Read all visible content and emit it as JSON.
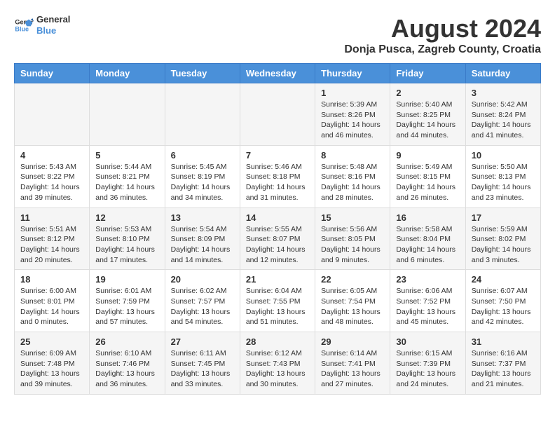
{
  "logo": {
    "line1": "General",
    "line2": "Blue"
  },
  "title": {
    "month_year": "August 2024",
    "location": "Donja Pusca, Zagreb County, Croatia"
  },
  "days_of_week": [
    "Sunday",
    "Monday",
    "Tuesday",
    "Wednesday",
    "Thursday",
    "Friday",
    "Saturday"
  ],
  "weeks": [
    [
      {
        "day": "",
        "info": ""
      },
      {
        "day": "",
        "info": ""
      },
      {
        "day": "",
        "info": ""
      },
      {
        "day": "",
        "info": ""
      },
      {
        "day": "1",
        "info": "Sunrise: 5:39 AM\nSunset: 8:26 PM\nDaylight: 14 hours\nand 46 minutes."
      },
      {
        "day": "2",
        "info": "Sunrise: 5:40 AM\nSunset: 8:25 PM\nDaylight: 14 hours\nand 44 minutes."
      },
      {
        "day": "3",
        "info": "Sunrise: 5:42 AM\nSunset: 8:24 PM\nDaylight: 14 hours\nand 41 minutes."
      }
    ],
    [
      {
        "day": "4",
        "info": "Sunrise: 5:43 AM\nSunset: 8:22 PM\nDaylight: 14 hours\nand 39 minutes."
      },
      {
        "day": "5",
        "info": "Sunrise: 5:44 AM\nSunset: 8:21 PM\nDaylight: 14 hours\nand 36 minutes."
      },
      {
        "day": "6",
        "info": "Sunrise: 5:45 AM\nSunset: 8:19 PM\nDaylight: 14 hours\nand 34 minutes."
      },
      {
        "day": "7",
        "info": "Sunrise: 5:46 AM\nSunset: 8:18 PM\nDaylight: 14 hours\nand 31 minutes."
      },
      {
        "day": "8",
        "info": "Sunrise: 5:48 AM\nSunset: 8:16 PM\nDaylight: 14 hours\nand 28 minutes."
      },
      {
        "day": "9",
        "info": "Sunrise: 5:49 AM\nSunset: 8:15 PM\nDaylight: 14 hours\nand 26 minutes."
      },
      {
        "day": "10",
        "info": "Sunrise: 5:50 AM\nSunset: 8:13 PM\nDaylight: 14 hours\nand 23 minutes."
      }
    ],
    [
      {
        "day": "11",
        "info": "Sunrise: 5:51 AM\nSunset: 8:12 PM\nDaylight: 14 hours\nand 20 minutes."
      },
      {
        "day": "12",
        "info": "Sunrise: 5:53 AM\nSunset: 8:10 PM\nDaylight: 14 hours\nand 17 minutes."
      },
      {
        "day": "13",
        "info": "Sunrise: 5:54 AM\nSunset: 8:09 PM\nDaylight: 14 hours\nand 14 minutes."
      },
      {
        "day": "14",
        "info": "Sunrise: 5:55 AM\nSunset: 8:07 PM\nDaylight: 14 hours\nand 12 minutes."
      },
      {
        "day": "15",
        "info": "Sunrise: 5:56 AM\nSunset: 8:05 PM\nDaylight: 14 hours\nand 9 minutes."
      },
      {
        "day": "16",
        "info": "Sunrise: 5:58 AM\nSunset: 8:04 PM\nDaylight: 14 hours\nand 6 minutes."
      },
      {
        "day": "17",
        "info": "Sunrise: 5:59 AM\nSunset: 8:02 PM\nDaylight: 14 hours\nand 3 minutes."
      }
    ],
    [
      {
        "day": "18",
        "info": "Sunrise: 6:00 AM\nSunset: 8:01 PM\nDaylight: 14 hours\nand 0 minutes."
      },
      {
        "day": "19",
        "info": "Sunrise: 6:01 AM\nSunset: 7:59 PM\nDaylight: 13 hours\nand 57 minutes."
      },
      {
        "day": "20",
        "info": "Sunrise: 6:02 AM\nSunset: 7:57 PM\nDaylight: 13 hours\nand 54 minutes."
      },
      {
        "day": "21",
        "info": "Sunrise: 6:04 AM\nSunset: 7:55 PM\nDaylight: 13 hours\nand 51 minutes."
      },
      {
        "day": "22",
        "info": "Sunrise: 6:05 AM\nSunset: 7:54 PM\nDaylight: 13 hours\nand 48 minutes."
      },
      {
        "day": "23",
        "info": "Sunrise: 6:06 AM\nSunset: 7:52 PM\nDaylight: 13 hours\nand 45 minutes."
      },
      {
        "day": "24",
        "info": "Sunrise: 6:07 AM\nSunset: 7:50 PM\nDaylight: 13 hours\nand 42 minutes."
      }
    ],
    [
      {
        "day": "25",
        "info": "Sunrise: 6:09 AM\nSunset: 7:48 PM\nDaylight: 13 hours\nand 39 minutes."
      },
      {
        "day": "26",
        "info": "Sunrise: 6:10 AM\nSunset: 7:46 PM\nDaylight: 13 hours\nand 36 minutes."
      },
      {
        "day": "27",
        "info": "Sunrise: 6:11 AM\nSunset: 7:45 PM\nDaylight: 13 hours\nand 33 minutes."
      },
      {
        "day": "28",
        "info": "Sunrise: 6:12 AM\nSunset: 7:43 PM\nDaylight: 13 hours\nand 30 minutes."
      },
      {
        "day": "29",
        "info": "Sunrise: 6:14 AM\nSunset: 7:41 PM\nDaylight: 13 hours\nand 27 minutes."
      },
      {
        "day": "30",
        "info": "Sunrise: 6:15 AM\nSunset: 7:39 PM\nDaylight: 13 hours\nand 24 minutes."
      },
      {
        "day": "31",
        "info": "Sunrise: 6:16 AM\nSunset: 7:37 PM\nDaylight: 13 hours\nand 21 minutes."
      }
    ]
  ]
}
